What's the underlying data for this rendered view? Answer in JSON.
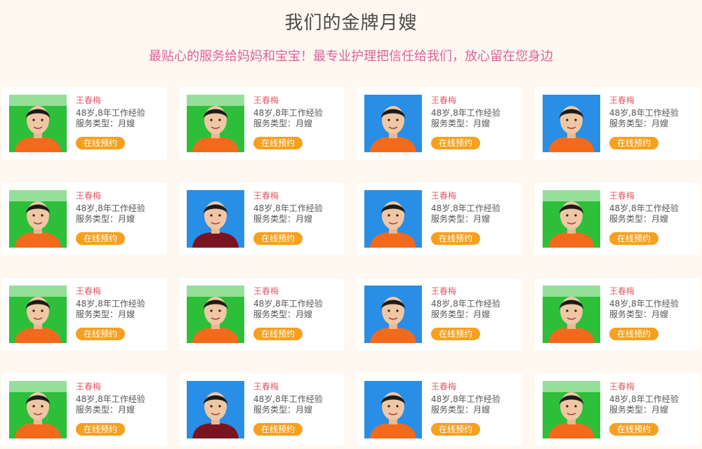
{
  "page": {
    "title": "我们的金牌月嫂",
    "subtitle": "最贴心的服务给妈妈和宝宝！最专业护理把信任给我们，放心留在您身边"
  },
  "colors": {
    "background": "#fff8f0",
    "title": "#4a4a4a",
    "subtitle": "#e0609a",
    "name": "#e05c6a",
    "button": "#f6a020",
    "photo_green": "#2dbf3a",
    "photo_blue": "#1e88e5",
    "shirt_orange": "#f36a1c",
    "shirt_darkred": "#7a1420"
  },
  "nannies": [
    {
      "name": "王春梅",
      "age_exp": "48岁,8年工作经验",
      "service": "服务类型：月嫂",
      "button": "在线预约",
      "photo_bg": "green",
      "shirt": "orange"
    },
    {
      "name": "王春梅",
      "age_exp": "48岁,8年工作经验",
      "service": "服务类型：月嫂",
      "button": "在线预约",
      "photo_bg": "green",
      "shirt": "orange"
    },
    {
      "name": "王春梅",
      "age_exp": "48岁,8年工作经验",
      "service": "服务类型：月嫂",
      "button": "在线预约",
      "photo_bg": "blue",
      "shirt": "orange"
    },
    {
      "name": "王春梅",
      "age_exp": "48岁,8年工作经验",
      "service": "服务类型：月嫂",
      "button": "在线预约",
      "photo_bg": "blue",
      "shirt": "orange"
    },
    {
      "name": "王春梅",
      "age_exp": "48岁,8年工作经验",
      "service": "服务类型：月嫂",
      "button": "在线预约",
      "photo_bg": "green",
      "shirt": "orange"
    },
    {
      "name": "王春梅",
      "age_exp": "48岁,8年工作经验",
      "service": "服务类型：月嫂",
      "button": "在线预约",
      "photo_bg": "blue",
      "shirt": "darkred"
    },
    {
      "name": "王春梅",
      "age_exp": "48岁,8年工作经验",
      "service": "服务类型：月嫂",
      "button": "在线预约",
      "photo_bg": "blue",
      "shirt": "orange"
    },
    {
      "name": "王春梅",
      "age_exp": "48岁,8年工作经验",
      "service": "服务类型：月嫂",
      "button": "在线预约",
      "photo_bg": "green",
      "shirt": "orange"
    },
    {
      "name": "王春梅",
      "age_exp": "48岁,8年工作经验",
      "service": "服务类型：月嫂",
      "button": "在线预约",
      "photo_bg": "green",
      "shirt": "orange"
    },
    {
      "name": "王春梅",
      "age_exp": "48岁,8年工作经验",
      "service": "服务类型：月嫂",
      "button": "在线预约",
      "photo_bg": "green",
      "shirt": "orange"
    },
    {
      "name": "王春梅",
      "age_exp": "48岁,8年工作经验",
      "service": "服务类型：月嫂",
      "button": "在线预约",
      "photo_bg": "blue",
      "shirt": "orange"
    },
    {
      "name": "王春梅",
      "age_exp": "48岁,8年工作经验",
      "service": "服务类型：月嫂",
      "button": "在线预约",
      "photo_bg": "green",
      "shirt": "orange"
    },
    {
      "name": "王春梅",
      "age_exp": "48岁,8年工作经验",
      "service": "服务类型：月嫂",
      "button": "在线预约",
      "photo_bg": "green",
      "shirt": "orange"
    },
    {
      "name": "王春梅",
      "age_exp": "48岁,8年工作经验",
      "service": "服务类型：月嫂",
      "button": "在线预约",
      "photo_bg": "blue",
      "shirt": "darkred"
    },
    {
      "name": "王春梅",
      "age_exp": "48岁,8年工作经验",
      "service": "服务类型：月嫂",
      "button": "在线预约",
      "photo_bg": "blue",
      "shirt": "orange"
    },
    {
      "name": "王春梅",
      "age_exp": "48岁,8年工作经验",
      "service": "服务类型：月嫂",
      "button": "在线预约",
      "photo_bg": "green",
      "shirt": "orange"
    }
  ]
}
